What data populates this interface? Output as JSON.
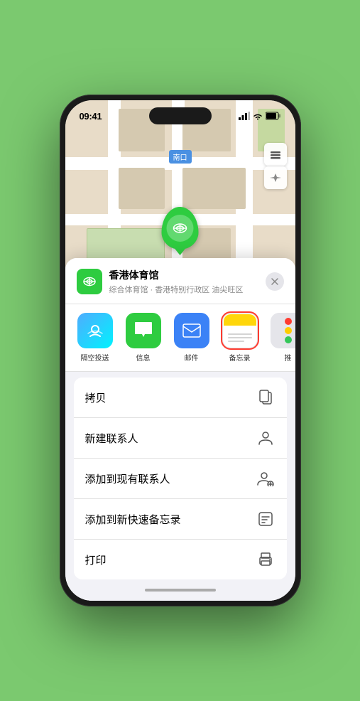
{
  "status_bar": {
    "time": "09:41",
    "time_icon": "location-arrow"
  },
  "map": {
    "label": "南口",
    "stadium_name": "香港体育馆",
    "stadium_label": "香港体育馆"
  },
  "location_card": {
    "name": "香港体育馆",
    "subtitle": "综合体育馆 · 香港特别行政区 油尖旺区",
    "close_label": "×"
  },
  "share_items": [
    {
      "id": "airdrop",
      "label": "隔空投送",
      "bg": "airdrop"
    },
    {
      "id": "messages",
      "label": "信息",
      "bg": "messages"
    },
    {
      "id": "mail",
      "label": "邮件",
      "bg": "mail"
    },
    {
      "id": "notes",
      "label": "备忘录",
      "bg": "notes",
      "selected": true
    },
    {
      "id": "more",
      "label": "推",
      "bg": "more"
    }
  ],
  "actions": [
    {
      "id": "copy",
      "label": "拷贝",
      "icon": "copy"
    },
    {
      "id": "new-contact",
      "label": "新建联系人",
      "icon": "person"
    },
    {
      "id": "add-contact",
      "label": "添加到现有联系人",
      "icon": "person-add"
    },
    {
      "id": "quick-note",
      "label": "添加到新快速备忘录",
      "icon": "note"
    },
    {
      "id": "print",
      "label": "打印",
      "icon": "print"
    }
  ]
}
